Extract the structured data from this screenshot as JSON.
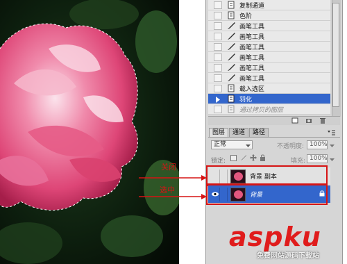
{
  "history": {
    "items": [
      {
        "label": "复制通道",
        "icon": "snapshot-icon",
        "state": "normal"
      },
      {
        "label": "色阶",
        "icon": "snapshot-icon",
        "state": "normal"
      },
      {
        "label": "画笔工具",
        "icon": "brush-icon",
        "state": "normal"
      },
      {
        "label": "画笔工具",
        "icon": "brush-icon",
        "state": "normal"
      },
      {
        "label": "画笔工具",
        "icon": "brush-icon",
        "state": "normal"
      },
      {
        "label": "画笔工具",
        "icon": "brush-icon",
        "state": "normal"
      },
      {
        "label": "画笔工具",
        "icon": "brush-icon",
        "state": "normal"
      },
      {
        "label": "画笔工具",
        "icon": "brush-icon",
        "state": "normal"
      },
      {
        "label": "载入选区",
        "icon": "snapshot-icon",
        "state": "normal"
      },
      {
        "label": "羽化",
        "icon": "snapshot-icon",
        "state": "selected"
      },
      {
        "label": "通过拷贝的图层",
        "icon": "snapshot-icon",
        "state": "disabled"
      }
    ]
  },
  "layers_panel": {
    "tabs": [
      "图层",
      "通道",
      "路径"
    ],
    "active_tab": 0,
    "blend_mode": "正常",
    "opacity_label": "不透明度:",
    "opacity_value": "100%",
    "lock_label": "锁定:",
    "fill_label": "填充:",
    "fill_value": "100%",
    "layers": [
      {
        "name": "背景 副本",
        "visible": false,
        "selected": false
      },
      {
        "name": "背景",
        "visible": true,
        "selected": true
      }
    ]
  },
  "annotations": {
    "close": "关闭",
    "select": "选中"
  },
  "watermark": {
    "brand": "aspku",
    "subtitle": "免费网站源码下载站"
  },
  "colors": {
    "selection": "#3366cc",
    "annotation": "#d61414",
    "panel": "#d6d6d6"
  }
}
